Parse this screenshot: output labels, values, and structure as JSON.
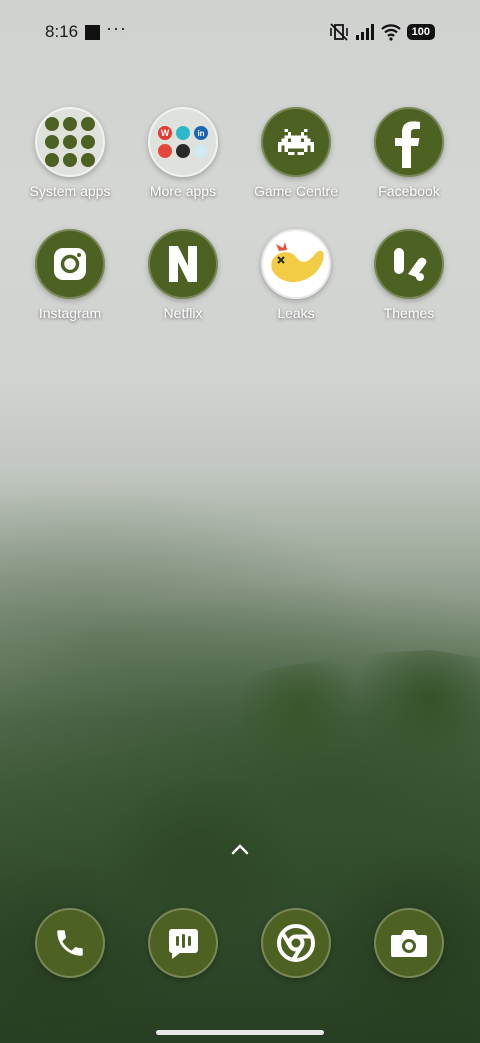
{
  "status_bar": {
    "time": "8:16",
    "more_indicator": "···",
    "battery": "100",
    "icons": [
      "screenshot-square-icon",
      "mute-vibrate-icon",
      "cellular-signal-icon",
      "wifi-icon",
      "battery-icon"
    ]
  },
  "apps": [
    {
      "name": "System apps",
      "icon": "folder-system-apps"
    },
    {
      "name": "More apps",
      "icon": "folder-more-apps"
    },
    {
      "name": "Game Centre",
      "icon": "space-invader-icon"
    },
    {
      "name": "Facebook",
      "icon": "facebook-icon"
    },
    {
      "name": "Instagram",
      "icon": "instagram-icon"
    },
    {
      "name": "Netflix",
      "icon": "netflix-icon"
    },
    {
      "name": "Leaks",
      "icon": "yellow-bird-icon"
    },
    {
      "name": "Themes",
      "icon": "themes-icon"
    }
  ],
  "more_apps_folder": {
    "badges": [
      "W",
      "in"
    ]
  },
  "dock": [
    {
      "name": "Phone",
      "icon": "phone-icon"
    },
    {
      "name": "Messages",
      "icon": "message-icon"
    },
    {
      "name": "Chrome",
      "icon": "chrome-icon"
    },
    {
      "name": "Camera",
      "icon": "camera-icon"
    }
  ],
  "colors": {
    "icon_bg": "#4d6122",
    "label": "#ffffff"
  }
}
